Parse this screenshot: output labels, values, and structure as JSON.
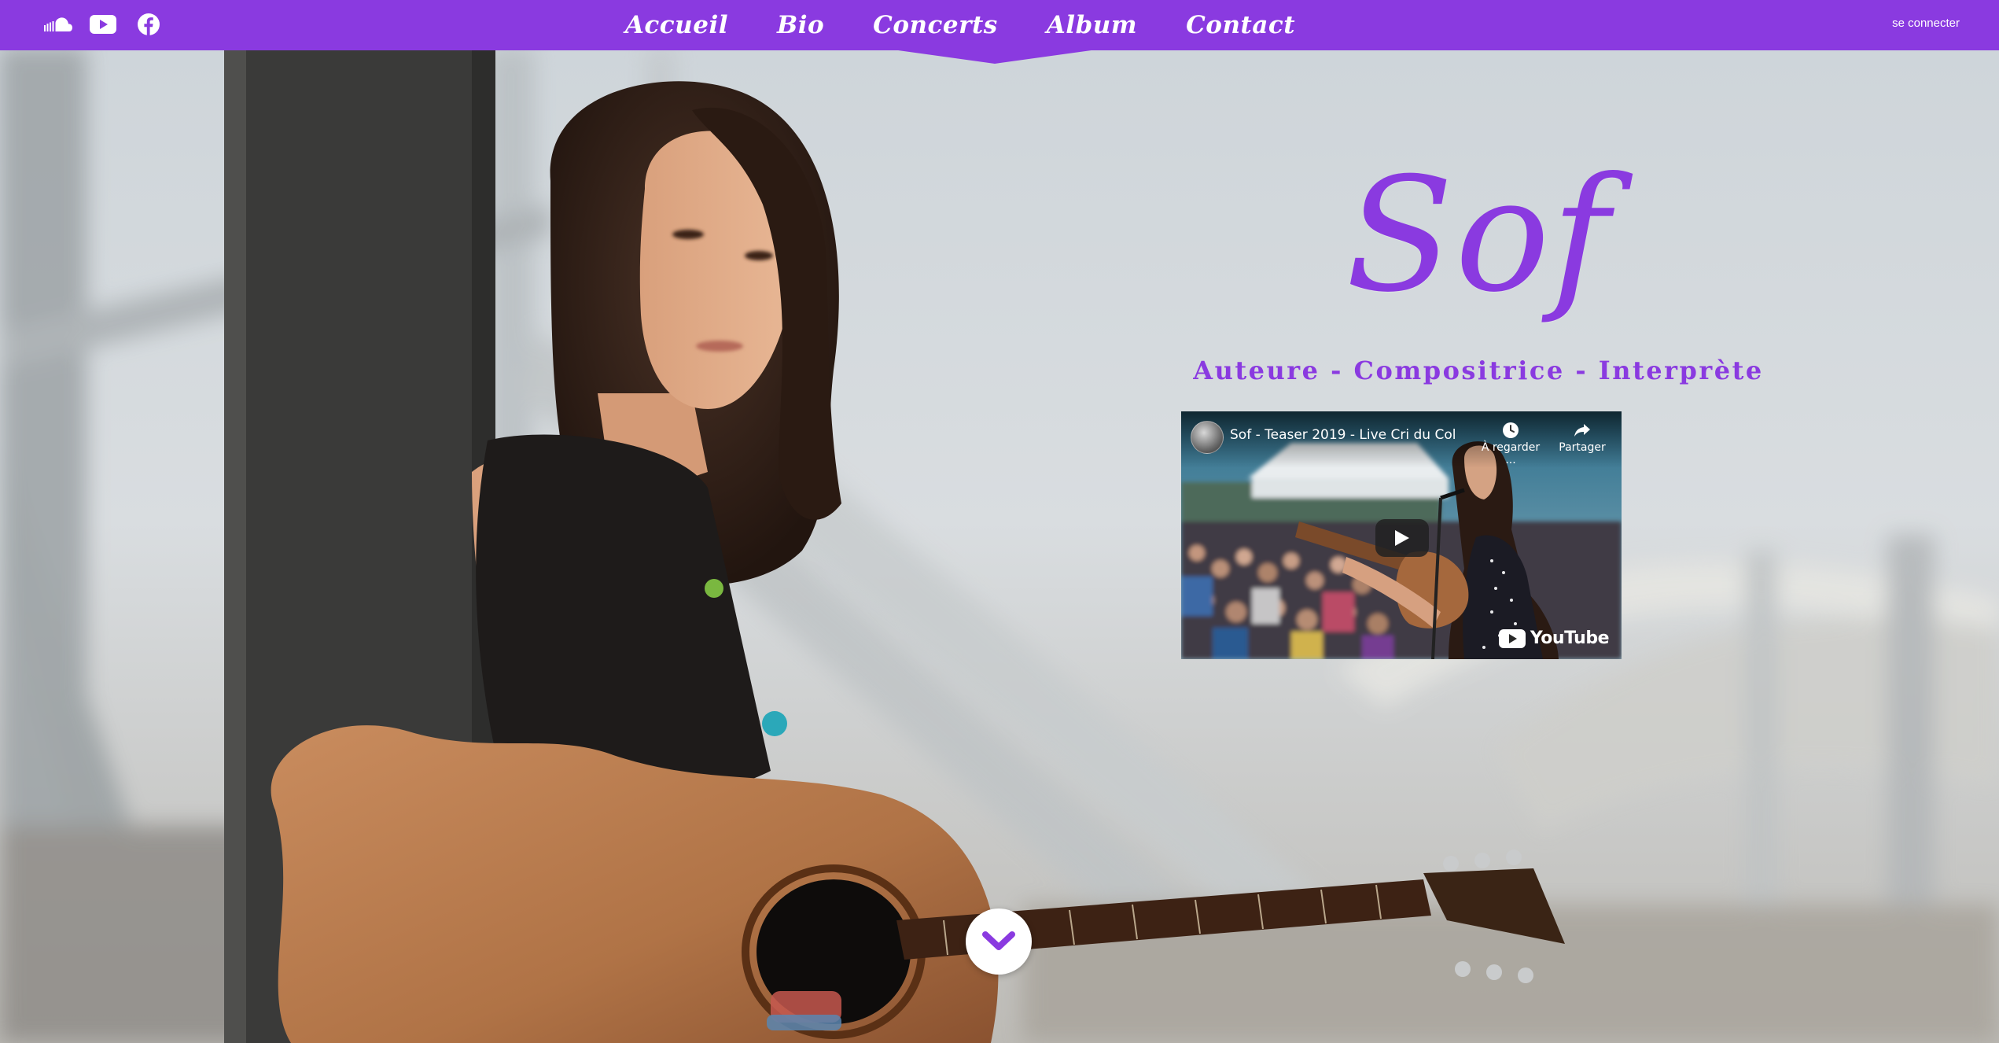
{
  "header": {
    "social": [
      {
        "name": "soundcloud",
        "icon": "soundcloud-icon"
      },
      {
        "name": "youtube",
        "icon": "youtube-icon"
      },
      {
        "name": "facebook",
        "icon": "facebook-icon"
      }
    ],
    "nav": [
      {
        "label": "Accueil"
      },
      {
        "label": "Bio"
      },
      {
        "label": "Concerts"
      },
      {
        "label": "Album"
      },
      {
        "label": "Contact"
      }
    ],
    "login_label": "se connecter"
  },
  "hero": {
    "title": "Sof",
    "tagline": "Auteure - Compositrice - Interprète",
    "video": {
      "title": "Sof - Teaser 2019 - Live Cri du Col",
      "watch_later_label": "À regarder ...",
      "share_label": "Partager",
      "brand_label": "YouTube"
    },
    "scroll_icon": "chevron-down-icon"
  },
  "colors": {
    "accent": "#8a3ae0",
    "nav_text": "#ffffff"
  }
}
